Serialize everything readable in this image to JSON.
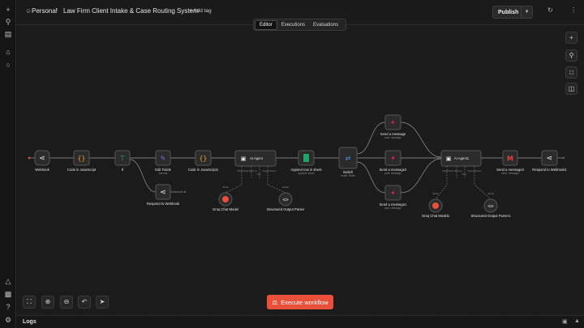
{
  "header": {
    "breadcrumb_root": "Personal",
    "workflow_name": "Law Firm Client Intake & Case Routing System",
    "add_tag": "+ Add tag",
    "publish_label": "Publish"
  },
  "tabs": [
    {
      "label": "Editor",
      "active": true
    },
    {
      "label": "Executions",
      "active": false
    },
    {
      "label": "Evaluations",
      "active": false
    }
  ],
  "execute_label": "Execute workflow",
  "logs_label": "Logs",
  "colors": {
    "accent": "#e8503a",
    "canvas": "#1b1b1b",
    "node": "#2b2b2b",
    "code_icon": "#f0a030",
    "if_icon": "#35b58a",
    "edit_icon": "#8a6cf0",
    "sheet_icon": "#21a366",
    "switch_icon": "#4a90d9",
    "groq": "#e8503a"
  },
  "nodes": [
    {
      "id": "webhook",
      "label": "Webhook",
      "sub": "",
      "icon": "webhook-icon"
    },
    {
      "id": "code1",
      "label": "Code in JavaScript",
      "sub": "",
      "icon": "code-icon"
    },
    {
      "id": "if",
      "label": "If",
      "sub": "",
      "icon": "if-icon"
    },
    {
      "id": "edit",
      "label": "Edit Fields",
      "sub": "manual",
      "icon": "pencil-icon"
    },
    {
      "id": "respond1",
      "label": "Respond to Webhook",
      "sub": "",
      "icon": "webhook-icon"
    },
    {
      "id": "code2",
      "label": "Code in JavaScript1",
      "sub": "",
      "icon": "code-icon"
    },
    {
      "id": "agent1",
      "label": "AI Agent",
      "sub": "",
      "icon": "robot-icon"
    },
    {
      "id": "groq1",
      "label": "Groq Chat Model",
      "sub": "",
      "icon": "groq-icon"
    },
    {
      "id": "parser1",
      "label": "Structured Output Parser",
      "sub": "",
      "icon": "parser-icon"
    },
    {
      "id": "sheet",
      "label": "Append row in sheet",
      "sub": "append: sheet",
      "icon": "sheets-icon"
    },
    {
      "id": "switch",
      "label": "Switch",
      "sub": "mode: Rules",
      "icon": "switch-icon"
    },
    {
      "id": "slack1",
      "label": "Send a message",
      "sub": "post: message",
      "icon": "slack-icon"
    },
    {
      "id": "slack2",
      "label": "Send a message2",
      "sub": "post: message",
      "icon": "slack-icon"
    },
    {
      "id": "slack3",
      "label": "Send a message1",
      "sub": "post: message",
      "icon": "slack-icon"
    },
    {
      "id": "agent2",
      "label": "AI Agent1",
      "sub": "",
      "icon": "robot-icon"
    },
    {
      "id": "groq2",
      "label": "Groq Chat Model1",
      "sub": "",
      "icon": "groq-icon"
    },
    {
      "id": "parser2",
      "label": "Structured Output Parser1",
      "sub": "",
      "icon": "parser-icon"
    },
    {
      "id": "gmail",
      "label": "Send a message3",
      "sub": "send: message",
      "icon": "gmail-icon"
    },
    {
      "id": "respond2",
      "label": "Respond to Webhook1",
      "sub": "",
      "icon": "webhook-icon"
    }
  ],
  "ports": {
    "chat_model": "Chat Model",
    "memory": "Memory",
    "tool": "Tool",
    "output_parser": "Output Parser",
    "model": "Model"
  }
}
